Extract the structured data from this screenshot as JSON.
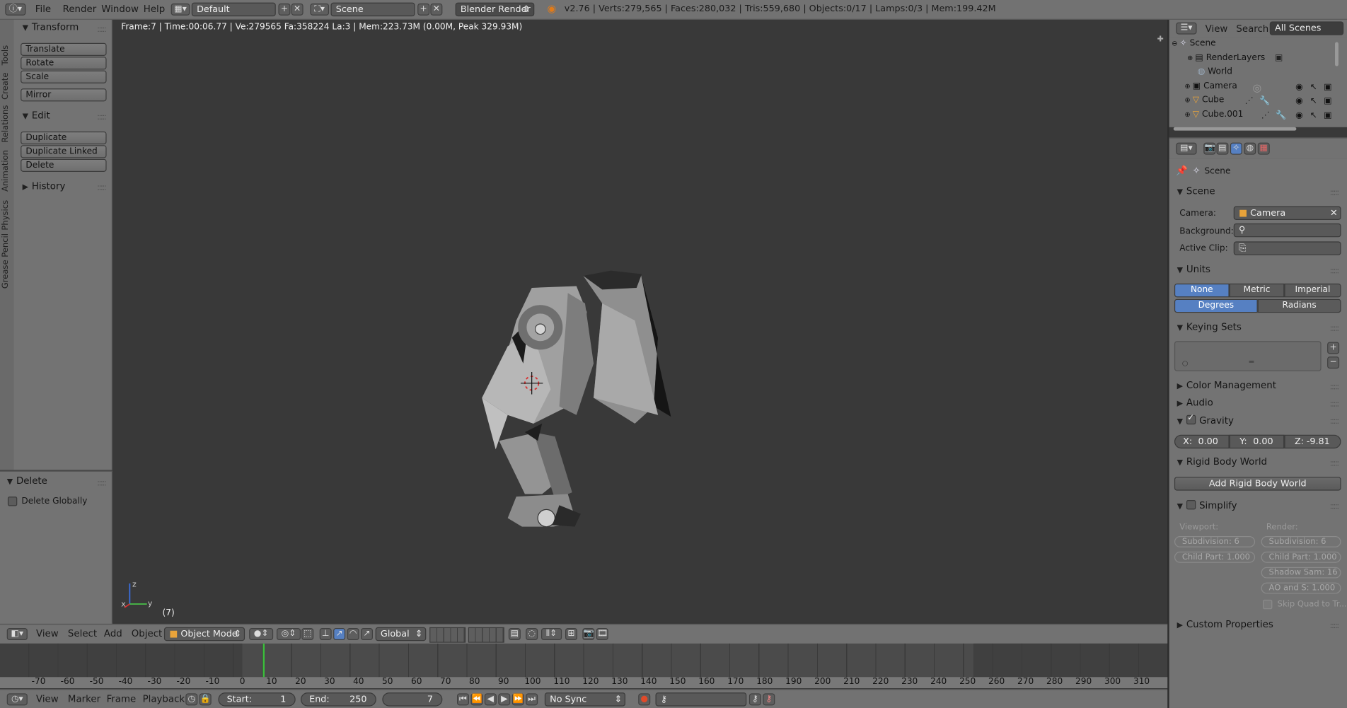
{
  "top_bar": {
    "menus": [
      "File",
      "Render",
      "Window",
      "Help"
    ],
    "screen_layout": "Default",
    "scene": "Scene",
    "engine": "Blender Render",
    "stats": "v2.76 | Verts:279,565 | Faces:280,032 | Tris:559,680 | Objects:0/17 | Lamps:0/3 | Mem:199.42M"
  },
  "viewport": {
    "info": "Frame:7 | Time:00:06.77 | Ve:279565 Fa:358224 La:3 | Mem:223.73M (0.00M, Peak 329.93M)",
    "frame_label": "(7)",
    "axis_x": "x",
    "axis_y": "y",
    "axis_z": "z"
  },
  "tool_tabs": [
    "Tools",
    "Create",
    "Relations",
    "Animation",
    "Physics",
    "Grease Pencil"
  ],
  "tool_shelf": {
    "transform_title": "Transform",
    "transform_buttons": [
      "Translate",
      "Rotate",
      "Scale"
    ],
    "mirror": "Mirror",
    "edit_title": "Edit",
    "edit_buttons": [
      "Duplicate",
      "Duplicate Linked",
      "Delete"
    ],
    "history_title": "History",
    "operator_title": "Delete",
    "delete_globally": "Delete Globally"
  },
  "view3d_header": {
    "menus": [
      "View",
      "Select",
      "Add",
      "Object"
    ],
    "mode": "Object Mode",
    "orientation": "Global"
  },
  "timeline": {
    "ticks": [
      "-70",
      "-60",
      "-50",
      "-40",
      "-30",
      "-20",
      "-10",
      "0",
      "10",
      "20",
      "30",
      "40",
      "50",
      "60",
      "70",
      "80",
      "90",
      "100",
      "110",
      "120",
      "130",
      "140",
      "150",
      "160",
      "170",
      "180",
      "190",
      "200",
      "210",
      "220",
      "230",
      "240",
      "250",
      "260",
      "270",
      "280",
      "290",
      "300",
      "310"
    ],
    "current_frame_value": 7,
    "menus": [
      "View",
      "Marker",
      "Frame",
      "Playback"
    ],
    "start_label": "Start:",
    "start": "1",
    "end_label": "End:",
    "end": "250",
    "current": "7",
    "sync": "No Sync"
  },
  "outliner": {
    "menus": [
      "View",
      "Search"
    ],
    "filter": "All Scenes",
    "items": [
      "Scene",
      "RenderLayers",
      "World",
      "Camera",
      "Cube",
      "Cube.001"
    ]
  },
  "properties": {
    "breadcrumb": "Scene",
    "scene_panel": "Scene",
    "camera_label": "Camera:",
    "camera_value": "Camera",
    "background_label": "Background:",
    "active_clip_label": "Active Clip:",
    "units_panel": "Units",
    "unit_systems": [
      "None",
      "Metric",
      "Imperial"
    ],
    "rotation_units": [
      "Degrees",
      "Radians"
    ],
    "keying_sets_panel": "Keying Sets",
    "color_management_panel": "Color Management",
    "audio_panel": "Audio",
    "gravity_panel": "Gravity",
    "gravity_x_label": "X:",
    "gravity_x": "0.00",
    "gravity_y_label": "Y:",
    "gravity_y": "0.00",
    "gravity_z_label": "Z:",
    "gravity_z": "-9.81",
    "rigid_body_panel": "Rigid Body World",
    "add_rigid_body": "Add Rigid Body World",
    "simplify_panel": "Simplify",
    "viewport_label": "Viewport:",
    "render_label": "Render:",
    "vp_subdivision": "Subdivision:    6",
    "vp_child_part": "Child Part: 1.000",
    "r_subdivision": "Subdivision:    6",
    "r_child_part": "Child Part: 1.000",
    "r_shadow": "Shadow Sam: 16",
    "r_ao": "AO and S:  1.000",
    "r_skip_quad": "Skip Quad to Tr...",
    "custom_props_panel": "Custom Properties"
  },
  "colors": {
    "accent": "#5680c2",
    "viewport_bg": "#393939",
    "panel_bg": "#737373",
    "frame_marker": "#3bbf3b"
  }
}
